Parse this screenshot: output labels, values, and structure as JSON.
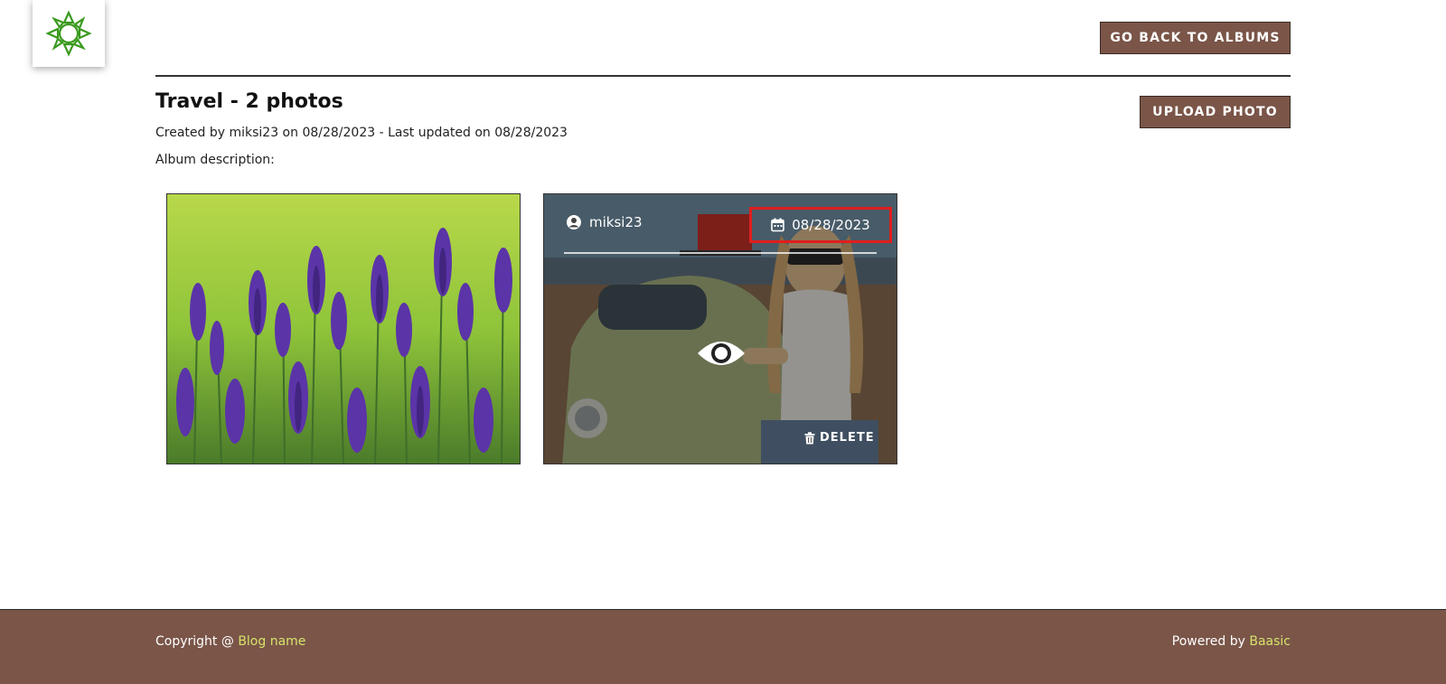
{
  "header": {
    "logo_icon": "sun-logo-icon",
    "back_button_label": "GO BACK TO ALBUMS"
  },
  "album": {
    "title": "Travel - 2 photos",
    "meta": "Created by miksi23 on 08/28/2023 - Last updated on 08/28/2023",
    "description_label": "Album description:",
    "upload_button_label": "UPLOAD PHOTO"
  },
  "photos": [
    {
      "subject": "lavender-field"
    },
    {
      "subject": "woman-and-car",
      "overlay": {
        "user": "miksi23",
        "date": "08/28/2023",
        "delete_label": "DELETE",
        "view_icon": "eye-icon",
        "user_icon": "user-circle-icon",
        "date_icon": "calendar-icon",
        "delete_icon": "trash-icon"
      }
    }
  ],
  "footer": {
    "copyright_prefix": "Copyright @ ",
    "copyright_link": "Blog name",
    "powered_prefix": "Powered by ",
    "powered_link": "Baasic"
  },
  "colors": {
    "button_bg": "#7a5548",
    "footer_bg": "#7a5548",
    "footer_link": "#d6e36b",
    "highlight_border": "#e01e1e",
    "logo_green": "#3a9a1e"
  }
}
